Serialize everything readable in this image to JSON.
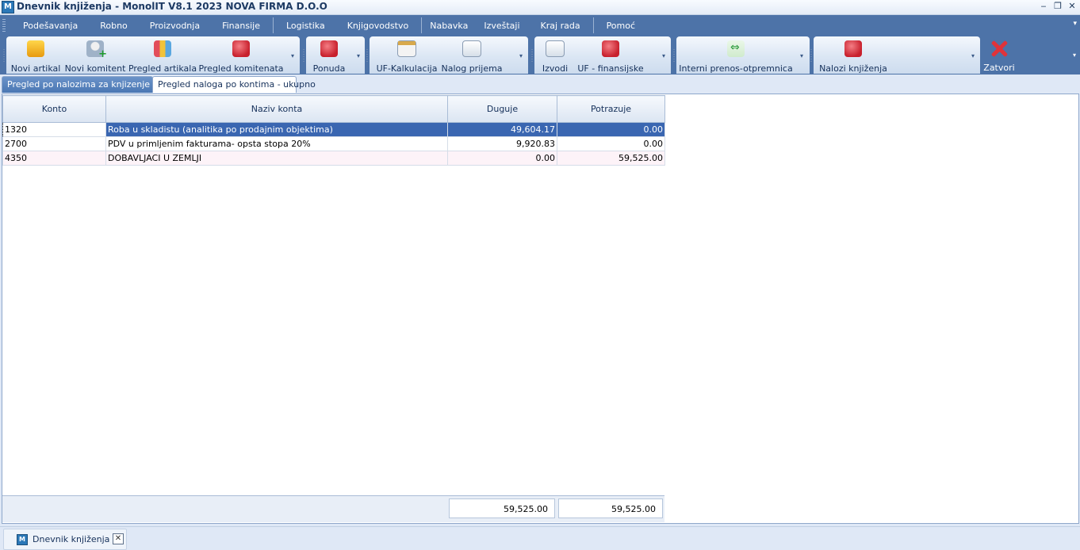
{
  "window": {
    "title": "Dnevnik knjiženja - MonolIT V8.1 2023 NOVA FIRMA D.O.O",
    "app_icon": "M",
    "controls": [
      "‒",
      "❐",
      "✕"
    ]
  },
  "menu": {
    "items": [
      "Podešavanja",
      "Robno",
      "Proizvodnja",
      "Finansije",
      "Logistika",
      "Knjigovodstvo",
      "Nabavka",
      "Izveštaji",
      "Kraj rada",
      "Pomoć"
    ]
  },
  "toolbar": {
    "buttons": [
      {
        "label": "Novi artikal",
        "icon": "shopping-bag-icon"
      },
      {
        "label": "Novi komitent",
        "icon": "add-user-icon"
      },
      {
        "label": "Pregled artikala",
        "icon": "items-icon"
      },
      {
        "label": "Pregled komitenata",
        "icon": "clients-icon"
      },
      {
        "label": "Ponuda",
        "icon": "offer-icon"
      },
      {
        "label": "UF-Kalkulacija",
        "icon": "calculation-icon"
      },
      {
        "label": "Nalog prijema",
        "icon": "receipt-icon"
      },
      {
        "label": "Izvodi",
        "icon": "statements-icon"
      },
      {
        "label": "UF - finansijske",
        "icon": "finance-icon"
      },
      {
        "label": "Interni prenos-otpremnica",
        "icon": "transfer-icon"
      },
      {
        "label": "Nalozi knjiženja",
        "icon": "book-icon"
      },
      {
        "label": "Zatvori",
        "icon": "close-icon"
      }
    ]
  },
  "tabs": [
    {
      "label": "Pregled po nalozima za knjizenje",
      "active": false
    },
    {
      "label": "Pregled naloga po kontima - ukupno",
      "active": true
    }
  ],
  "grid": {
    "columns": [
      "Konto",
      "Naziv konta",
      "Duguje",
      "Potrazuje"
    ],
    "rows": [
      {
        "konto": "1320",
        "naziv": "Roba u skladistu (analitika po prodajnim objektima)",
        "duguje": "49,604.17",
        "potrazuje": "0.00"
      },
      {
        "konto": "2700",
        "naziv": "PDV u primljenim fakturama- opsta stopa 20%",
        "duguje": "9,920.83",
        "potrazuje": "0.00"
      },
      {
        "konto": "4350",
        "naziv": "DOBAVLJACI U ZEMLJI",
        "duguje": "0.00",
        "potrazuje": "59,525.00"
      }
    ],
    "totals": {
      "duguje": "59,525.00",
      "potrazuje": "59,525.00"
    }
  },
  "bottom_tab": {
    "label": "Dnevnik knjiženja",
    "close": "✕"
  },
  "colors": {
    "menu_bg": "#4d73a8",
    "selection": "#3a66b1",
    "close_red": "#e0333a"
  }
}
